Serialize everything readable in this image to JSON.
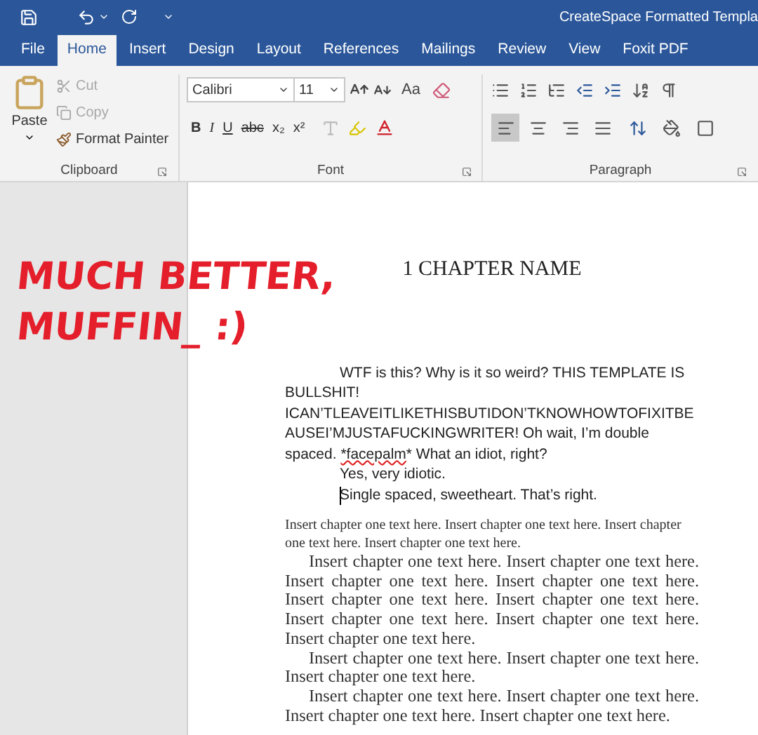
{
  "window": {
    "title": "CreateSpace Formatted Templa"
  },
  "tabs": [
    {
      "label": "File",
      "selected": false
    },
    {
      "label": "Home",
      "selected": true
    },
    {
      "label": "Insert",
      "selected": false
    },
    {
      "label": "Design",
      "selected": false
    },
    {
      "label": "Layout",
      "selected": false
    },
    {
      "label": "References",
      "selected": false
    },
    {
      "label": "Mailings",
      "selected": false
    },
    {
      "label": "Review",
      "selected": false
    },
    {
      "label": "View",
      "selected": false
    },
    {
      "label": "Foxit PDF",
      "selected": false
    }
  ],
  "clipboard": {
    "label": "Clipboard",
    "paste": "Paste",
    "items": [
      {
        "kind": "cut",
        "label": "Cut",
        "disabled": true
      },
      {
        "kind": "copy",
        "label": "Copy",
        "disabled": true
      },
      {
        "kind": "painter",
        "label": "Format Painter",
        "disabled": false
      }
    ]
  },
  "font": {
    "label": "Font",
    "name": "Calibri",
    "size": "11",
    "case_button": "Aa",
    "format_buttons": [
      {
        "label": "B",
        "kind": "bold"
      },
      {
        "label": "I",
        "kind": "italic"
      },
      {
        "label": "U",
        "kind": "underline"
      },
      {
        "label": "abc",
        "kind": "strike"
      },
      {
        "label": "x₂",
        "kind": "plain"
      },
      {
        "label": "x²",
        "kind": "plain"
      }
    ]
  },
  "paragraph": {
    "label": "Paragraph",
    "alignments": [
      {
        "kind": "left",
        "selected": true
      },
      {
        "kind": "center",
        "selected": false
      },
      {
        "kind": "right",
        "selected": false
      },
      {
        "kind": "justify",
        "selected": false
      }
    ]
  },
  "annotation": [
    "MUCH BETTER,",
    "MUFFIN_ :)"
  ],
  "document": {
    "heading": "1 CHAPTER NAME",
    "paragraphs": [
      {
        "kind": "sans",
        "indent": true,
        "cursor": false,
        "segments": [
          {
            "text": "WTF is this? Why is it so weird? THIS TEMPLATE IS BULLSHIT! ICAN’TLEAVEITLIKETHISBUTIDON’TKNOWHOWTOFIXITBEAUSEI’MJUSTAFUCKINGWRITER! Oh wait, I’m double spaced. ",
            "misspelled": false
          },
          {
            "text": "*facepalm",
            "misspelled": true
          },
          {
            "text": "* What an idiot, right?",
            "misspelled": false
          }
        ]
      },
      {
        "kind": "sans",
        "indent": true,
        "cursor": false,
        "segments": [
          {
            "text": "Yes, very idiotic.",
            "misspelled": false
          }
        ]
      },
      {
        "kind": "sans",
        "indent": true,
        "cursor": true,
        "segments": [
          {
            "text": "Single spaced, sweetheart. That’s right.",
            "misspelled": false
          }
        ]
      },
      {
        "kind": "serif_small",
        "indent": false,
        "cursor": false,
        "segments": [
          {
            "text": "Insert chapter one text here. Insert chapter one text here. Insert chapter one text here. Insert chapter one text here.",
            "misspelled": false
          }
        ]
      },
      {
        "kind": "serif",
        "indent": true,
        "cursor": false,
        "segments": [
          {
            "text": "Insert chapter one text here. Insert chapter one text here. Insert chapter one text here. Insert chapter one text here. Insert chapter one text here. Insert chapter one text here. Insert chapter one text here. Insert chapter one text here. Insert chapter one text here.",
            "misspelled": false
          }
        ]
      },
      {
        "kind": "serif",
        "indent": true,
        "cursor": false,
        "segments": [
          {
            "text": "Insert chapter one text here. Insert chapter one text here. Insert chapter one text here.",
            "misspelled": false
          }
        ]
      },
      {
        "kind": "serif",
        "indent": true,
        "cursor": false,
        "segments": [
          {
            "text": "Insert chapter one text here. Insert chapter one text here. Insert chapter one text here. Insert chapter one text here.",
            "misspelled": false
          }
        ]
      }
    ]
  }
}
